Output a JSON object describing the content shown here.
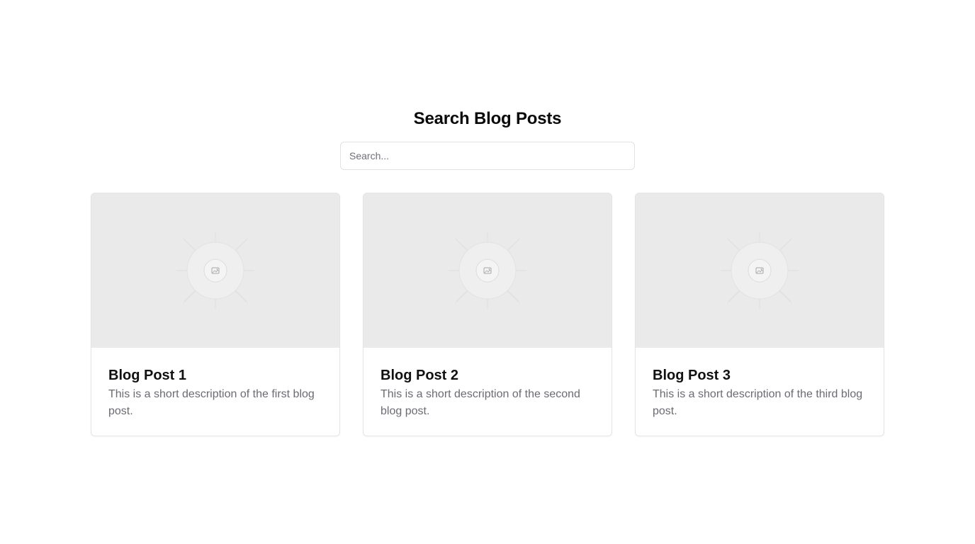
{
  "header": {
    "title": "Search Blog Posts"
  },
  "search": {
    "placeholder": "Search...",
    "value": ""
  },
  "posts": [
    {
      "title": "Blog Post 1",
      "description": "This is a short description of the first blog post.",
      "image_icon": "image-placeholder-icon"
    },
    {
      "title": "Blog Post 2",
      "description": "This is a short description of the second blog post.",
      "image_icon": "image-placeholder-icon"
    },
    {
      "title": "Blog Post 3",
      "description": "This is a short description of the third blog post.",
      "image_icon": "image-placeholder-icon"
    }
  ],
  "colors": {
    "background": "#ffffff",
    "image_placeholder": "#eaeaea",
    "border": "#e4e4e7",
    "title_text": "#111111",
    "muted_text": "#6b6b73"
  }
}
